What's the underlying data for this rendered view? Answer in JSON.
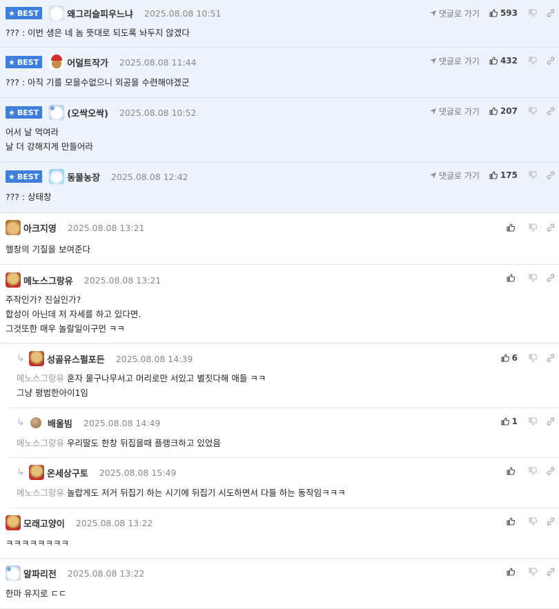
{
  "ui": {
    "best_label": "BEST",
    "goto_label": "댓글로 가기",
    "icons": {
      "best": "star-icon",
      "goto": "paper-plane-icon",
      "like": "thumbs-up-icon",
      "dislike": "thumbs-down-icon",
      "share": "link-icon",
      "reply": "reply-arrow-icon"
    },
    "colors": {
      "best_bg": "#eef3fb",
      "badge": "#3d7fdb",
      "mention": "#999999"
    }
  },
  "comments": [
    {
      "nick": "왜그리슬피우느냐",
      "date": "2025.08.08 10:51",
      "likes": "593",
      "lines": [
        "??? : 이번 생은 네 놈 뜻대로 되도록 놔두지 않겠다"
      ]
    },
    {
      "nick": "어덜트작가",
      "date": "2025.08.08 11:44",
      "likes": "432",
      "lines": [
        "??? : 아직 기를 모을수없으니 외공을 수련해야겠군"
      ]
    },
    {
      "nick": "(오싹오싹)",
      "date": "2025.08.08 10:52",
      "likes": "207",
      "lines": [
        "어서 날 먹여라",
        "날 더 강해지게 만들어라"
      ]
    },
    {
      "nick": "동물농장",
      "date": "2025.08.08 12:42",
      "likes": "175",
      "lines": [
        "??? : 상태창"
      ]
    },
    {
      "nick": "아크지영",
      "date": "2025.08.08 13:21",
      "likes": "",
      "lines": [
        "헬창의 기질을 보여준다"
      ]
    },
    {
      "nick": "메노스그랑유",
      "date": "2025.08.08 13:21",
      "likes": "",
      "lines": [
        "주작인가? 진실인가?",
        "합성이 아닌데 저 자세를 하고 있다면.",
        "그것또한 매우 놀랄일이구먼 ㅋㅋ"
      ]
    },
    {
      "nick": "성골유스펄포든",
      "date": "2025.08.08 14:39",
      "likes": "6",
      "mention": "메노스그랑유",
      "lines": [
        "혼자 물구나무서고 머리로만 서있고 별짓다해 애들 ㅋㅋ",
        "그냥 평범한아이1임"
      ]
    },
    {
      "nick": "배울빔",
      "date": "2025.08.08 14:49",
      "likes": "1",
      "mention": "메노스그랑유",
      "lines": [
        "우리딸도 한창 뒤집을때 플랭크하고 있었음"
      ]
    },
    {
      "nick": "온세상구토",
      "date": "2025.08.08 15:49",
      "likes": "",
      "mention": "메노스그랑유",
      "lines": [
        "놀랍게도 저거 뒤집기 하는 시기에 뒤집기 시도하면서 다들 하는 동작임ㅋㅋㅋ"
      ]
    },
    {
      "nick": "모래고양이",
      "date": "2025.08.08 13:22",
      "likes": "",
      "lines": [
        "ㅋㅋㅋㅋㅋㅋㅋㅋ"
      ]
    },
    {
      "nick": "알파리전",
      "date": "2025.08.08 13:22",
      "likes": "",
      "lines": [
        "한마 유지로 ㄷㄷ"
      ]
    }
  ]
}
